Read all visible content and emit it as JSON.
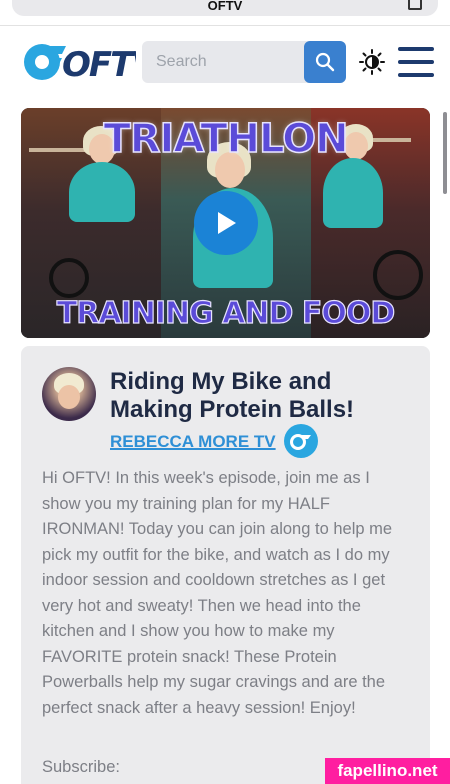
{
  "browser": {
    "url_text": "OFTV"
  },
  "header": {
    "logo_text": "OFTV",
    "search_placeholder": "Search"
  },
  "video": {
    "title_top": "TRIATHLON",
    "title_bottom": "TRAINING AND FOOD"
  },
  "episode": {
    "title": "Riding My Bike and Making Protein Balls!",
    "creator": "REBECCA MORE TV",
    "description": "Hi OFTV! In this week's episode, join me as I show you my training plan for my HALF IRONMAN! Today you can join along to help me pick my outfit for the bike, and watch as I do my indoor session and cooldown stretches as I get very hot and sweaty! Then we head into the kitchen and I show you how to make my FAVORITE protein snack! These Protein Powerballs help my sugar cravings and are the perfect snack after a heavy session! Enjoy!",
    "subscribe_label": "Subscribe:"
  },
  "watermark": "fapellino.net",
  "colors": {
    "brand_blue": "#2aa6e0",
    "navy": "#1d3a6e",
    "link": "#2e8fd6",
    "button": "#3a80cf",
    "watermark": "#ff1ea0"
  },
  "icons": {
    "search": "search-icon",
    "theme": "sun-icon",
    "menu": "hamburger-menu-icon",
    "play": "play-icon",
    "tabs": "tabs-icon"
  }
}
